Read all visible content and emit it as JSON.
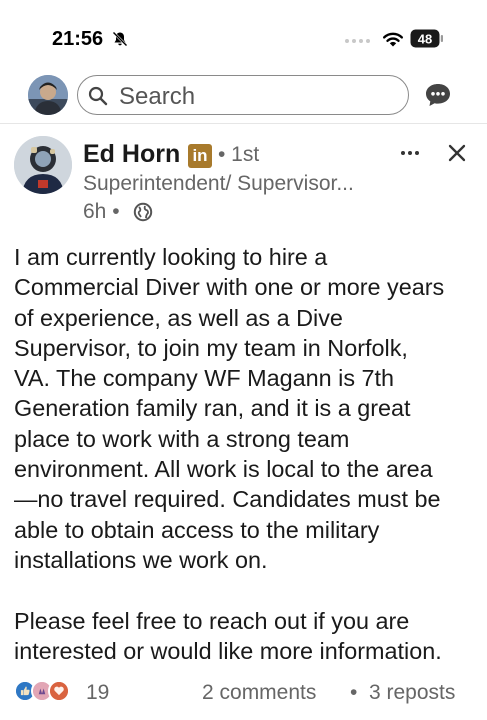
{
  "status_bar": {
    "time": "21:56",
    "battery": "48"
  },
  "header": {
    "search_placeholder": "Search"
  },
  "post": {
    "author": "Ed Horn",
    "linkedin_badge": "in",
    "degree": "• 1st",
    "headline": "Superintendent/ Supervisor...",
    "time_ago": "6h •",
    "body": "I am currently looking to hire a\nCommercial Diver with one or more years\nof experience, as well as a Dive\nSupervisor, to join my team in Norfolk,\nVA. The company WF Magann is 7th\nGeneration family ran, and it is a great\nplace to work with a strong team\nenvironment. All work is local to the area\n—no travel required. Candidates must be\nable to obtain access to the military\ninstallations we work on.\n\nPlease feel free to reach out if you are\ninterested or would like more information.",
    "reaction_count": "19",
    "comments": "2 comments",
    "separator": "•",
    "reposts": "3 reposts"
  },
  "colors": {
    "accent_gold": "#a87a2c",
    "text_primary": "#1a1a1a",
    "text_secondary": "#666666"
  },
  "icons": [
    "bell-slash-icon",
    "wifi-icon",
    "battery-icon",
    "search-icon",
    "messaging-icon",
    "globe-icon",
    "more-icon",
    "close-icon",
    "like-reaction-icon",
    "celebrate-reaction-icon",
    "love-reaction-icon"
  ]
}
